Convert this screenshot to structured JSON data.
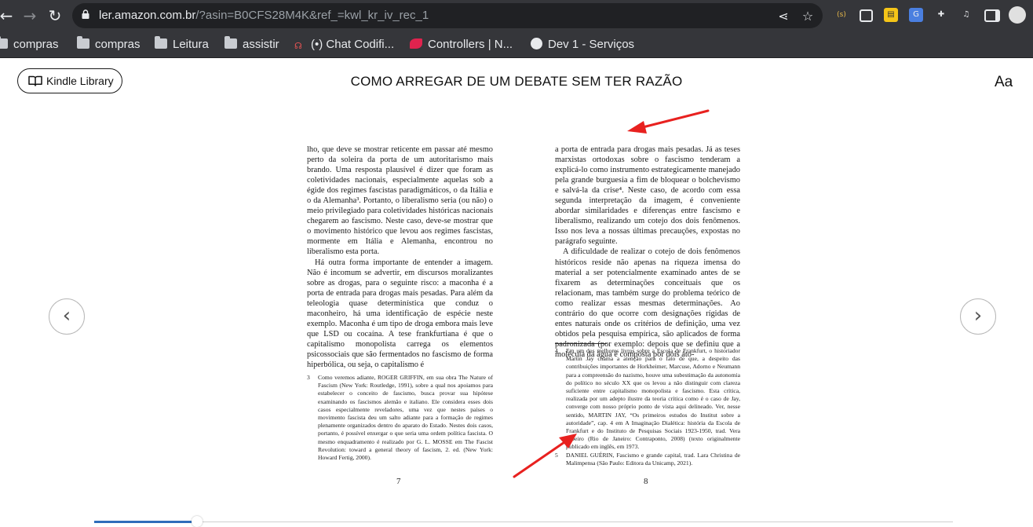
{
  "browser": {
    "url_domain": "ler.amazon.com.br",
    "url_path": "/?asin=B0CFS28M4K&ref_=kwl_kr_iv_rec_1",
    "back_icon": "arrow-left-icon",
    "forward_icon": "arrow-right-icon",
    "reload_icon": "reload-icon",
    "extensions": [
      "share-icon",
      "star-icon",
      "extension-s-icon",
      "window-icon",
      "note-icon",
      "translate-icon",
      "puzzle-icon",
      "media-icon",
      "sidepanel-icon",
      "avatar"
    ],
    "colors": {
      "frame": "#35363a",
      "omnibox": "#202124",
      "text": "#e8eaed"
    }
  },
  "bookmarks": [
    {
      "label": "compras",
      "icon": "folder-icon"
    },
    {
      "label": "compras",
      "icon": "folder-icon"
    },
    {
      "label": "Leitura",
      "icon": "folder-icon"
    },
    {
      "label": "assistir",
      "icon": "folder-icon"
    },
    {
      "label": "(•) Chat Codifi...",
      "icon": "chat-icon"
    },
    {
      "label": "Controllers | N...",
      "icon": "nest-icon"
    },
    {
      "label": "Dev 1 - Serviços",
      "icon": "globe-icon"
    }
  ],
  "reader": {
    "library_button": "Kindle Library",
    "title": "COMO ARREGAR DE UM DEBATE SEM TER RAZÃO",
    "font_settings": "Aa",
    "prev_label": "‹",
    "next_label": "›",
    "progress_fraction": 0.12
  },
  "left_page": {
    "paragraphs": [
      {
        "indent": false,
        "text": "lho, que deve se mostrar reticente em passar até mesmo perto da soleira da porta de um autoritarismo mais brando. Uma resposta plausível é dizer que foram as coletividades nacionais, especialmente aquelas sob a égide dos regimes fascistas paradigmáticos, o da Itália e o da Alemanha³. Portanto, o liberalismo seria (ou não) o meio privilegiado para coletividades históricas nacionais chegarem ao fascismo. Neste caso, deve-se mostrar que o movimento histórico que levou aos regimes fascistas, mormente em Itália e Alemanha, encontrou no liberalismo esta porta."
      },
      {
        "indent": true,
        "text": "Há outra forma importante de entender a imagem. Não é incomum se advertir, em discursos moralizantes sobre as drogas, para o seguinte risco: a maconha é a porta de entrada para drogas mais pesadas. Para além da teleologia quase determinística que conduz o maconheiro, há uma identificação de espécie neste exemplo. Maconha é um tipo de droga embora mais leve que LSD ou cocaína. A tese frankfurtiana é que o capitalismo monopolista carrega os elementos psicossociais que são fermentados no fascismo de forma hiperbólica, ou seja, o capitalismo é"
      }
    ],
    "footnotes": [
      {
        "num": "3",
        "text": "Como veremos adiante, ROGER GRIFFIN, em sua obra The Nature of Fascism (New York: Routledge, 1991), sobre a qual nos apoiamos para estabelecer o conceito de fascismo, busca provar sua hipótese examinando os fascismos alemão e italiano. Ele considera esses dois casos especialmente reveladores, uma vez que nestes países o movimento fascista deu um salto adiante para a formação de regimes plenamente organizados dentro do aparato do Estado. Nestes dois casos, portanto, é possível enxergar o que seria uma ordem política fascista. O mesmo enquadramento é realizado por G. L. MOSSE em The Fascist Revolution: toward a general theory of fascism, 2. ed. (New York: Howard Fertig, 2000)."
      }
    ],
    "page_number": "7"
  },
  "right_page": {
    "paragraphs": [
      {
        "indent": false,
        "text": "a porta de entrada para drogas mais pesadas. Já as teses marxistas ortodoxas sobre o fascismo tenderam a explicá-lo como instrumento estrategicamente manejado pela grande burguesia a fim de bloquear o bolchevismo e salvá-la da crise⁴. Neste caso, de acordo com essa segunda interpretação da imagem, é conveniente abordar similaridades e diferenças entre fascismo e liberalismo, realizando um cotejo dos dois fenômenos. Isso nos leva a nossas últimas precauções, expostas no parágrafo seguinte."
      },
      {
        "indent": true,
        "text": "A dificuldade de realizar o cotejo de dois fenômenos históricos reside não apenas na riqueza imensa do material a ser potencialmente examinado antes de se fixarem as determinações conceituais que os relacionam, mas também surge do problema teórico de como realizar essas mesmas determinações. Ao contrário do que ocorre com designações rígidas de entes naturais onde os critérios de definição, uma vez obtidos pela pesquisa empírica, são aplicados de forma padronizada (por exemplo: depois que se definiu que a molécula da água é composta por dois áto-"
      }
    ],
    "footnotes": [
      {
        "num": "4",
        "text": "Em um dos melhores livros sobre a Escola de Frankfurt, o historiador Martin Jay chama a atenção para o fato de que, a despeito das contribuições importantes de Horkheimer, Marcuse, Adorno e Neumann para a compreensão do nazismo, houve uma subestimação da autonomia do político no século XX que os levou a não distinguir com clareza suficiente entre capitalismo monopolista e fascismo. Esta crítica, realizada por um adepto ilustre da teoria crítica como é o caso de Jay, converge com nosso próprio ponto de vista aqui delineado. Ver, nesse sentido, MARTIN JAY, “Os primeiros estudos do Institut sobre a autoridade”, cap. 4 em A Imaginação Dialética: história da Escola de Frankfurt e do Instituto de Pesquisas Sociais 1923-1950, trad. Vera Ribeiro (Rio de Janeiro: Contraponto, 2008) (texto originalmente publicado em inglês, em 1973."
      },
      {
        "num": "5",
        "text": "DANIEL GUÉRIN, Fascismo e grande capital, trad. Lara Christina de Malimpensa (São Paulo: Editora da Unicamp, 2021)."
      }
    ],
    "page_number": "8"
  },
  "annotations": {
    "arrow_color": "#e8211f"
  }
}
